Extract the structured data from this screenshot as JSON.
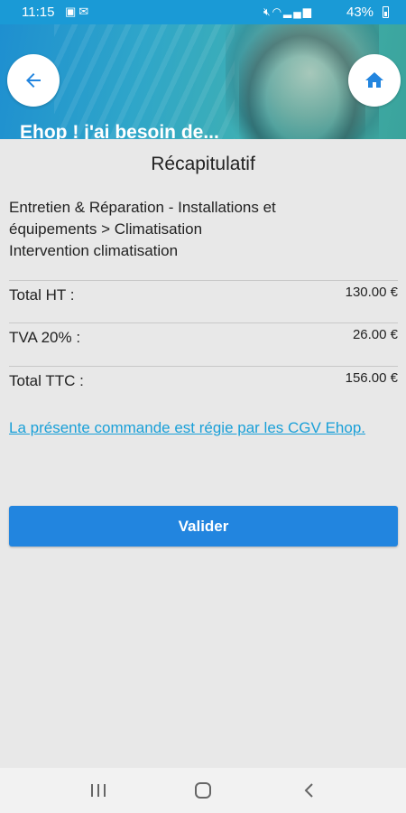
{
  "status_bar": {
    "time": "11:15",
    "notification_icons": [
      "image-icon",
      "mail-icon"
    ],
    "system_icons": [
      "mute-icon",
      "wifi-icon",
      "signal-icon"
    ],
    "battery_text": "43%"
  },
  "header": {
    "title": "Ehop ! j'ai besoin de...",
    "back_icon": "arrow-left-icon",
    "home_icon": "home-icon",
    "accent_color": "#2285df"
  },
  "summary": {
    "title": "Récapitulatif",
    "description_line1": "Entretien & Réparation - Installations et",
    "description_line2": "équipements > Climatisation",
    "description_line3": "Intervention climatisation",
    "rows": [
      {
        "label": "Total HT :",
        "value": "130.00 €"
      },
      {
        "label": "TVA 20% :",
        "value": "26.00 €"
      },
      {
        "label": "Total TTC :",
        "value": "156.00 €"
      }
    ],
    "cgv_link_text": "La présente commande est régie par les CGV Ehop.",
    "validate_label": "Valider"
  },
  "nav_bar": {
    "icons": [
      "recent-apps-icon",
      "home-circle-icon",
      "back-chevron-icon"
    ]
  }
}
